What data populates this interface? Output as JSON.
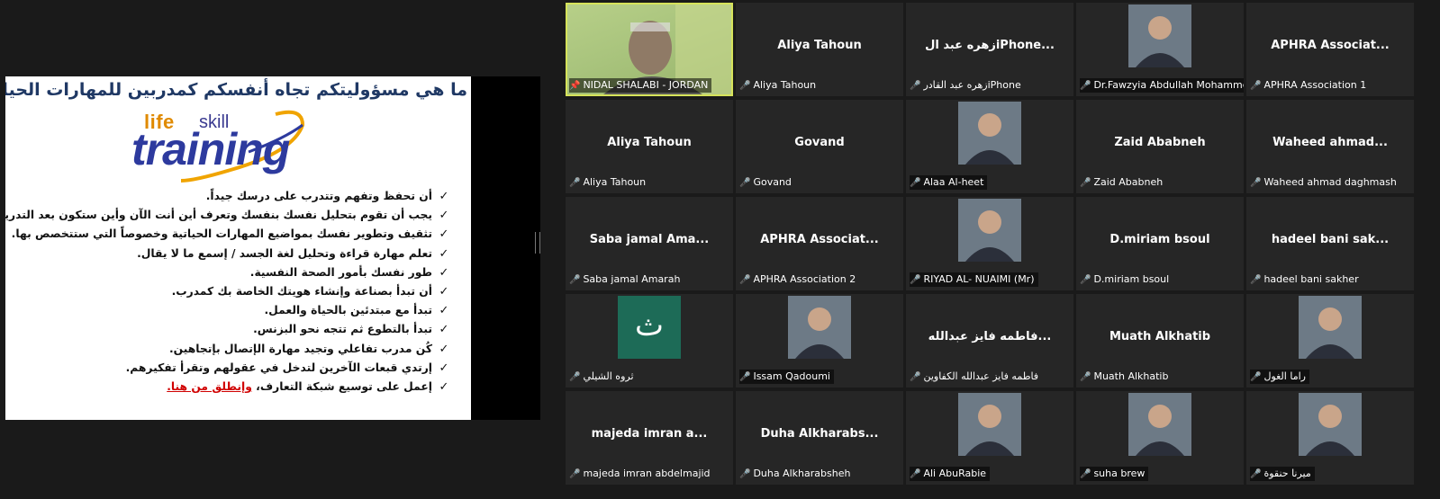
{
  "slide": {
    "title": "ما هي مسؤوليتكم تجاه أنفسكم كمدربين للمهارات الحياتية!!",
    "logo": {
      "life": "life",
      "skill": "skill",
      "training": "training"
    },
    "bullets": [
      {
        "text": "أن تحفظ وتفهم وتتدرب على درسك جيداً."
      },
      {
        "text": "يجب أن تقوم بتحليل نفسك بنفسك وتعرف أين أنت الآن وأين ستكون بعد التدريب."
      },
      {
        "text": "تثقيف وتطوير نفسك بمواضيع المهارات الحياتية وخصوصاً التي ستتخصص بها."
      },
      {
        "text": "تعلم مهارة قراءة وتحليل لغة الجسد / إسمع ما لا يقال."
      },
      {
        "text": "طور نفسك بأمور الصحة النفسية."
      },
      {
        "text": "أن تبدأ بصناعة وإنشاء هويتك الخاصة بك كمدرب."
      },
      {
        "text": "تبدأ مع مبتدئين بالحياة والعمل."
      },
      {
        "text": "تبدأ بالتطوع ثم تتجه نحو البزنس."
      },
      {
        "text": "كُن مدرب تفاعلي وتجيد مهارة الإتصال بإتجاهين."
      },
      {
        "text": "إرتدي قبعات الآخرين لتدخل في عقولهم وتقرأ تفكيرهم."
      },
      {
        "text": "إعمل على توسيع شبكة التعارف،",
        "emph": "وإنطلق من هنا."
      }
    ],
    "check_glyph": "✓"
  },
  "gallery": {
    "mic_glyph": "🎤",
    "pin_glyph": "📌",
    "tiles": [
      {
        "kind": "video",
        "label": "NIDAL SHALABI - JORDAN",
        "pinned": true
      },
      {
        "kind": "name",
        "big": "Aliya Tahoun",
        "label": "Aliya Tahoun"
      },
      {
        "kind": "name",
        "big": "زهره عبد الiPhone...",
        "label": "زهره عبد القادرiPhone"
      },
      {
        "kind": "photo",
        "label": "Dr.Fawzyia Abdullah Mohammed"
      },
      {
        "kind": "name",
        "big": "APHRA  Associat...",
        "label": "APHRA Association 1"
      },
      {
        "kind": "name",
        "big": "Aliya Tahoun",
        "label": "Aliya Tahoun"
      },
      {
        "kind": "name",
        "big": "Govand",
        "label": "Govand"
      },
      {
        "kind": "photo",
        "label": "Alaa Al-heet"
      },
      {
        "kind": "name",
        "big": "Zaid Ababneh",
        "label": "Zaid Ababneh"
      },
      {
        "kind": "name",
        "big": "Waheed  ahmad...",
        "label": "Waheed ahmad daghmash"
      },
      {
        "kind": "name",
        "big": "Saba jamal Ama...",
        "label": "Saba jamal Amarah"
      },
      {
        "kind": "name",
        "big": "APHRA  Associat...",
        "label": "APHRA Association 2"
      },
      {
        "kind": "photo",
        "label": "RIYAD AL- NUAIMI (Mr)"
      },
      {
        "kind": "name",
        "big": "D.miriam bsoul",
        "label": "D.miriam bsoul"
      },
      {
        "kind": "name",
        "big": "hadeel bani sak...",
        "label": "hadeel bani sakher"
      },
      {
        "kind": "avatar",
        "letter": "ث",
        "label": "ثروه الشيلي"
      },
      {
        "kind": "photo",
        "label": "Issam Qadoumi"
      },
      {
        "kind": "name",
        "big": "فاطمه فايز عبدالله...",
        "label": "فاطمه فايز عبدالله الكفاوين"
      },
      {
        "kind": "name",
        "big": "Muath Alkhatib",
        "label": "Muath Alkhatib"
      },
      {
        "kind": "photo",
        "label": "راما الغول"
      },
      {
        "kind": "name",
        "big": "majeda imran a...",
        "label": "majeda imran abdelmajid"
      },
      {
        "kind": "name",
        "big": "Duha  Alkharabs...",
        "label": "Duha Alkharabsheh"
      },
      {
        "kind": "photo",
        "label": "Ali AbuRabie"
      },
      {
        "kind": "photo",
        "label": "suha brew"
      },
      {
        "kind": "photo",
        "label": "ميرنا حنقوة"
      }
    ]
  }
}
